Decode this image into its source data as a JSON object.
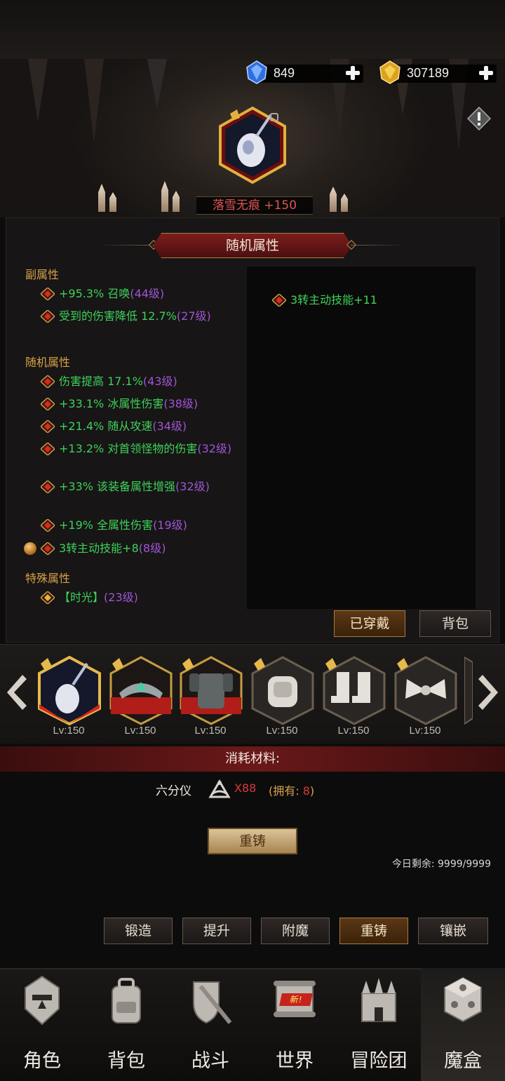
{
  "currency": {
    "gems": "849",
    "gold": "307189"
  },
  "equipped_item": {
    "name": "落雪无痕 +150"
  },
  "panel": {
    "title": "随机属性"
  },
  "sub_attributes": {
    "heading": "副属性",
    "items": [
      {
        "green": "+95.3% 召唤",
        "purple": "(44级)"
      },
      {
        "green": "受到的伤害降低 12.7%",
        "purple": "(27级)"
      }
    ]
  },
  "random_attributes": {
    "heading": "随机属性",
    "items": [
      {
        "green": "伤害提高 17.1%",
        "purple": "(43级)"
      },
      {
        "green": "+33.1% 冰属性伤害",
        "purple": "(38级)"
      },
      {
        "green": "+21.4% 随从攻速",
        "purple": "(34级)"
      },
      {
        "green": "+13.2% 对首领怪物的伤害",
        "purple": "(32级)"
      },
      {
        "green": "+33% 该装备属性增强",
        "purple": "(32级)"
      },
      {
        "green": "+19% 全属性伤害",
        "purple": "(19级)"
      },
      {
        "green": "3转主动技能+8",
        "purple": "(8级)"
      }
    ]
  },
  "special_attributes": {
    "heading": "特殊属性",
    "items": [
      {
        "green": "【时光】",
        "purple": "(23级)"
      }
    ]
  },
  "compare_attributes": {
    "items": [
      "3转主动技能+11"
    ]
  },
  "panel_buttons": {
    "equipped": "已穿戴",
    "backpack": "背包"
  },
  "equipment_strip": {
    "slots": [
      {
        "icon": "snow-scepter-icon",
        "level": "Lv:150",
        "rarity_color": "#d6271f"
      },
      {
        "icon": "crown-icon",
        "level": "Lv:150",
        "rarity_color": "#d6271f"
      },
      {
        "icon": "chest-armor-icon",
        "level": "Lv:150",
        "rarity_color": "#d6271f"
      },
      {
        "icon": "gauntlet-icon",
        "level": "Lv:150",
        "rarity_color": "#6b5e50"
      },
      {
        "icon": "boots-icon",
        "level": "Lv:150",
        "rarity_color": "#6b5e50"
      },
      {
        "icon": "bow-ornament-icon",
        "level": "Lv:150",
        "rarity_color": "#6b5e50"
      }
    ]
  },
  "consume": {
    "title": "消耗材料:",
    "material_name": "六分仪",
    "material_icon": "sextant-icon",
    "required": "X88",
    "owned_label_open": "(拥有: ",
    "owned_value": "8",
    "owned_label_close": ")"
  },
  "recast_button": "重铸",
  "daily_remaining": "今日剩余: 9999/9999",
  "function_tabs": [
    {
      "label": "锻造",
      "active": false
    },
    {
      "label": "提升",
      "active": false
    },
    {
      "label": "附魔",
      "active": false
    },
    {
      "label": "重铸",
      "active": true
    },
    {
      "label": "镶嵌",
      "active": false
    }
  ],
  "bottom_nav": [
    {
      "label": "角色",
      "icon": "helmet-icon"
    },
    {
      "label": "背包",
      "icon": "backpack-icon"
    },
    {
      "label": "战斗",
      "icon": "sword-shield-icon"
    },
    {
      "label": "世界",
      "icon": "scroll-map-icon",
      "badge": "新!"
    },
    {
      "label": "冒险团",
      "icon": "castle-icon"
    },
    {
      "label": "魔盒",
      "icon": "magic-cube-icon",
      "active": true
    }
  ],
  "colors": {
    "attr_green": "#3ed15b",
    "attr_purple": "#9e56d6",
    "section_gold": "#d6a24a",
    "item_name_red": "#e05454"
  }
}
